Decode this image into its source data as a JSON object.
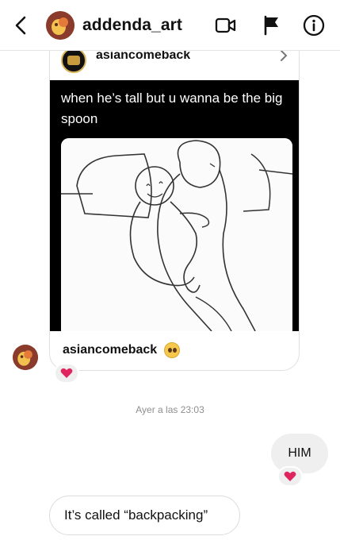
{
  "header": {
    "username": "addenda_art"
  },
  "shared_post": {
    "top_username": "asiancomeback",
    "caption": "when he’s tall but u wanna be the big spoon",
    "footer_username": "asiancomeback",
    "footer_emoji": "pleading-face"
  },
  "reactions": {
    "post": "heart",
    "him": "heart"
  },
  "timestamp": "Ayer a las 23:03",
  "messages": {
    "outgoing_text": "HIM",
    "incoming_text": "It’s called “backpacking”"
  },
  "colors": {
    "heart": "#e0245e",
    "meme_background": "#000000"
  }
}
